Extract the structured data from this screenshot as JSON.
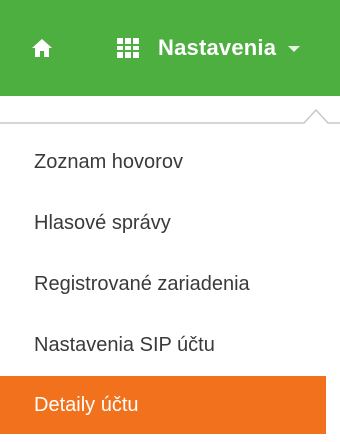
{
  "navbar": {
    "home_icon": "home-icon",
    "menu": {
      "icon": "grid-icon",
      "label": "Nastavenia",
      "caret_icon": "caret-down-icon"
    },
    "colors": {
      "bar": "#4caf3f",
      "active_item": "#f2711c"
    }
  },
  "dropdown": {
    "items": [
      {
        "label": "Zoznam hovorov",
        "active": false
      },
      {
        "label": "Hlasové správy",
        "active": false
      },
      {
        "label": "Registrované zariadenia",
        "active": false
      },
      {
        "label": "Nastavenia SIP účtu",
        "active": false
      },
      {
        "label": "Detaily účtu",
        "active": true
      }
    ]
  }
}
